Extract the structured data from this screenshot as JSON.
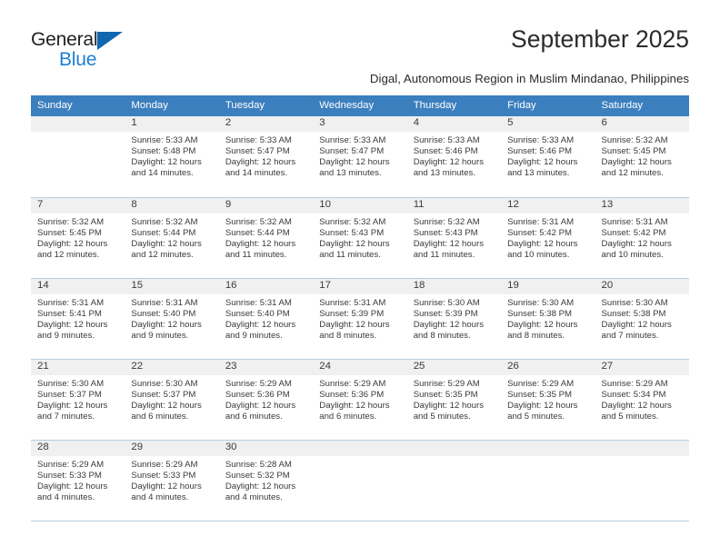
{
  "brand": {
    "name_part1": "General",
    "name_part2": "Blue",
    "accent_color": "#1c7fd4",
    "triangle_color": "#1166b0"
  },
  "header": {
    "month_title": "September 2025",
    "location_subtitle": "Digal, Autonomous Region in Muslim Mindanao, Philippines",
    "header_row_color": "#3c7fbe"
  },
  "weekday_headers": [
    "Sunday",
    "Monday",
    "Tuesday",
    "Wednesday",
    "Thursday",
    "Friday",
    "Saturday"
  ],
  "weeks": [
    [
      {
        "day": "",
        "sunrise": "",
        "sunset": "",
        "daylight_line1": "",
        "daylight_line2": ""
      },
      {
        "day": "1",
        "sunrise": "Sunrise: 5:33 AM",
        "sunset": "Sunset: 5:48 PM",
        "daylight_line1": "Daylight: 12 hours",
        "daylight_line2": "and 14 minutes."
      },
      {
        "day": "2",
        "sunrise": "Sunrise: 5:33 AM",
        "sunset": "Sunset: 5:47 PM",
        "daylight_line1": "Daylight: 12 hours",
        "daylight_line2": "and 14 minutes."
      },
      {
        "day": "3",
        "sunrise": "Sunrise: 5:33 AM",
        "sunset": "Sunset: 5:47 PM",
        "daylight_line1": "Daylight: 12 hours",
        "daylight_line2": "and 13 minutes."
      },
      {
        "day": "4",
        "sunrise": "Sunrise: 5:33 AM",
        "sunset": "Sunset: 5:46 PM",
        "daylight_line1": "Daylight: 12 hours",
        "daylight_line2": "and 13 minutes."
      },
      {
        "day": "5",
        "sunrise": "Sunrise: 5:33 AM",
        "sunset": "Sunset: 5:46 PM",
        "daylight_line1": "Daylight: 12 hours",
        "daylight_line2": "and 13 minutes."
      },
      {
        "day": "6",
        "sunrise": "Sunrise: 5:32 AM",
        "sunset": "Sunset: 5:45 PM",
        "daylight_line1": "Daylight: 12 hours",
        "daylight_line2": "and 12 minutes."
      }
    ],
    [
      {
        "day": "7",
        "sunrise": "Sunrise: 5:32 AM",
        "sunset": "Sunset: 5:45 PM",
        "daylight_line1": "Daylight: 12 hours",
        "daylight_line2": "and 12 minutes."
      },
      {
        "day": "8",
        "sunrise": "Sunrise: 5:32 AM",
        "sunset": "Sunset: 5:44 PM",
        "daylight_line1": "Daylight: 12 hours",
        "daylight_line2": "and 12 minutes."
      },
      {
        "day": "9",
        "sunrise": "Sunrise: 5:32 AM",
        "sunset": "Sunset: 5:44 PM",
        "daylight_line1": "Daylight: 12 hours",
        "daylight_line2": "and 11 minutes."
      },
      {
        "day": "10",
        "sunrise": "Sunrise: 5:32 AM",
        "sunset": "Sunset: 5:43 PM",
        "daylight_line1": "Daylight: 12 hours",
        "daylight_line2": "and 11 minutes."
      },
      {
        "day": "11",
        "sunrise": "Sunrise: 5:32 AM",
        "sunset": "Sunset: 5:43 PM",
        "daylight_line1": "Daylight: 12 hours",
        "daylight_line2": "and 11 minutes."
      },
      {
        "day": "12",
        "sunrise": "Sunrise: 5:31 AM",
        "sunset": "Sunset: 5:42 PM",
        "daylight_line1": "Daylight: 12 hours",
        "daylight_line2": "and 10 minutes."
      },
      {
        "day": "13",
        "sunrise": "Sunrise: 5:31 AM",
        "sunset": "Sunset: 5:42 PM",
        "daylight_line1": "Daylight: 12 hours",
        "daylight_line2": "and 10 minutes."
      }
    ],
    [
      {
        "day": "14",
        "sunrise": "Sunrise: 5:31 AM",
        "sunset": "Sunset: 5:41 PM",
        "daylight_line1": "Daylight: 12 hours",
        "daylight_line2": "and 9 minutes."
      },
      {
        "day": "15",
        "sunrise": "Sunrise: 5:31 AM",
        "sunset": "Sunset: 5:40 PM",
        "daylight_line1": "Daylight: 12 hours",
        "daylight_line2": "and 9 minutes."
      },
      {
        "day": "16",
        "sunrise": "Sunrise: 5:31 AM",
        "sunset": "Sunset: 5:40 PM",
        "daylight_line1": "Daylight: 12 hours",
        "daylight_line2": "and 9 minutes."
      },
      {
        "day": "17",
        "sunrise": "Sunrise: 5:31 AM",
        "sunset": "Sunset: 5:39 PM",
        "daylight_line1": "Daylight: 12 hours",
        "daylight_line2": "and 8 minutes."
      },
      {
        "day": "18",
        "sunrise": "Sunrise: 5:30 AM",
        "sunset": "Sunset: 5:39 PM",
        "daylight_line1": "Daylight: 12 hours",
        "daylight_line2": "and 8 minutes."
      },
      {
        "day": "19",
        "sunrise": "Sunrise: 5:30 AM",
        "sunset": "Sunset: 5:38 PM",
        "daylight_line1": "Daylight: 12 hours",
        "daylight_line2": "and 8 minutes."
      },
      {
        "day": "20",
        "sunrise": "Sunrise: 5:30 AM",
        "sunset": "Sunset: 5:38 PM",
        "daylight_line1": "Daylight: 12 hours",
        "daylight_line2": "and 7 minutes."
      }
    ],
    [
      {
        "day": "21",
        "sunrise": "Sunrise: 5:30 AM",
        "sunset": "Sunset: 5:37 PM",
        "daylight_line1": "Daylight: 12 hours",
        "daylight_line2": "and 7 minutes."
      },
      {
        "day": "22",
        "sunrise": "Sunrise: 5:30 AM",
        "sunset": "Sunset: 5:37 PM",
        "daylight_line1": "Daylight: 12 hours",
        "daylight_line2": "and 6 minutes."
      },
      {
        "day": "23",
        "sunrise": "Sunrise: 5:29 AM",
        "sunset": "Sunset: 5:36 PM",
        "daylight_line1": "Daylight: 12 hours",
        "daylight_line2": "and 6 minutes."
      },
      {
        "day": "24",
        "sunrise": "Sunrise: 5:29 AM",
        "sunset": "Sunset: 5:36 PM",
        "daylight_line1": "Daylight: 12 hours",
        "daylight_line2": "and 6 minutes."
      },
      {
        "day": "25",
        "sunrise": "Sunrise: 5:29 AM",
        "sunset": "Sunset: 5:35 PM",
        "daylight_line1": "Daylight: 12 hours",
        "daylight_line2": "and 5 minutes."
      },
      {
        "day": "26",
        "sunrise": "Sunrise: 5:29 AM",
        "sunset": "Sunset: 5:35 PM",
        "daylight_line1": "Daylight: 12 hours",
        "daylight_line2": "and 5 minutes."
      },
      {
        "day": "27",
        "sunrise": "Sunrise: 5:29 AM",
        "sunset": "Sunset: 5:34 PM",
        "daylight_line1": "Daylight: 12 hours",
        "daylight_line2": "and 5 minutes."
      }
    ],
    [
      {
        "day": "28",
        "sunrise": "Sunrise: 5:29 AM",
        "sunset": "Sunset: 5:33 PM",
        "daylight_line1": "Daylight: 12 hours",
        "daylight_line2": "and 4 minutes."
      },
      {
        "day": "29",
        "sunrise": "Sunrise: 5:29 AM",
        "sunset": "Sunset: 5:33 PM",
        "daylight_line1": "Daylight: 12 hours",
        "daylight_line2": "and 4 minutes."
      },
      {
        "day": "30",
        "sunrise": "Sunrise: 5:28 AM",
        "sunset": "Sunset: 5:32 PM",
        "daylight_line1": "Daylight: 12 hours",
        "daylight_line2": "and 4 minutes."
      },
      {
        "day": "",
        "sunrise": "",
        "sunset": "",
        "daylight_line1": "",
        "daylight_line2": ""
      },
      {
        "day": "",
        "sunrise": "",
        "sunset": "",
        "daylight_line1": "",
        "daylight_line2": ""
      },
      {
        "day": "",
        "sunrise": "",
        "sunset": "",
        "daylight_line1": "",
        "daylight_line2": ""
      },
      {
        "day": "",
        "sunrise": "",
        "sunset": "",
        "daylight_line1": "",
        "daylight_line2": ""
      }
    ]
  ]
}
